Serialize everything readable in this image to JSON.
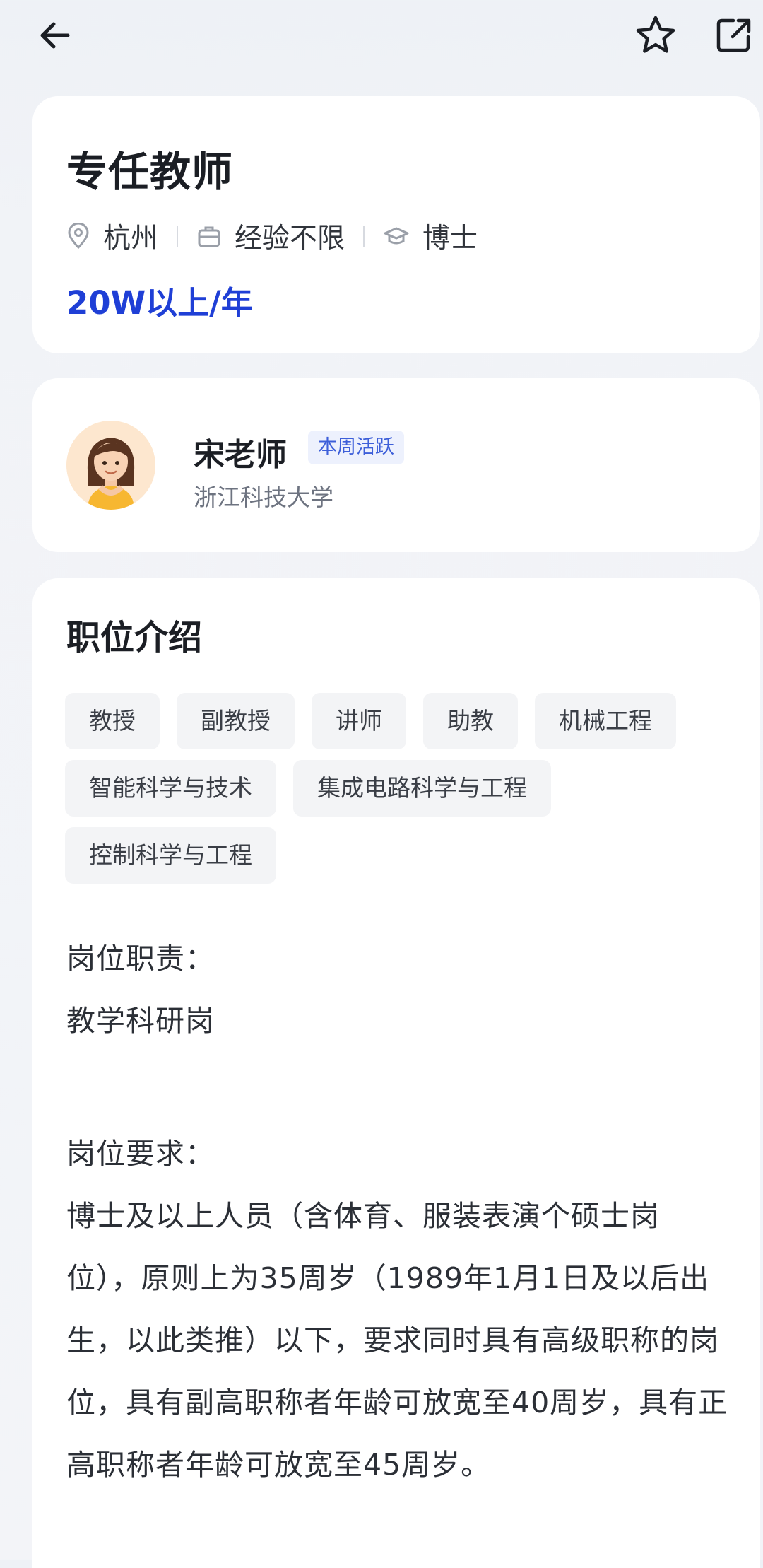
{
  "header": {
    "back_icon": "arrow-left-icon",
    "favorite_icon": "star-outline-icon",
    "share_icon": "share-out-icon"
  },
  "job": {
    "title": "专任教师",
    "location": "杭州",
    "experience": "经验不限",
    "education": "博士",
    "salary": "20W以上/年",
    "salary_color": "#1f3fd6"
  },
  "recruiter": {
    "name": "宋老师",
    "badge": "本周活跃",
    "organization": "浙江科技大学"
  },
  "description": {
    "section_title": "职位介绍",
    "tags": [
      "教授",
      "副教授",
      "讲师",
      "助教",
      "机械工程",
      "智能科学与技术",
      "集成电路科学与工程",
      "控制科学与工程"
    ],
    "duty_label": "岗位职责：",
    "duty_text": "教学科研岗",
    "requirement_label": "岗位要求：",
    "requirement_text": "博士及以上人员（含体育、服装表演个硕士岗位），原则上为35周岁（1989年1月1日及以后出生，以此类推）以下，要求同时具有高级职称的岗位，具有副高职称者年龄可放宽至40周岁，具有正高职称者年龄可放宽至45周岁。"
  }
}
